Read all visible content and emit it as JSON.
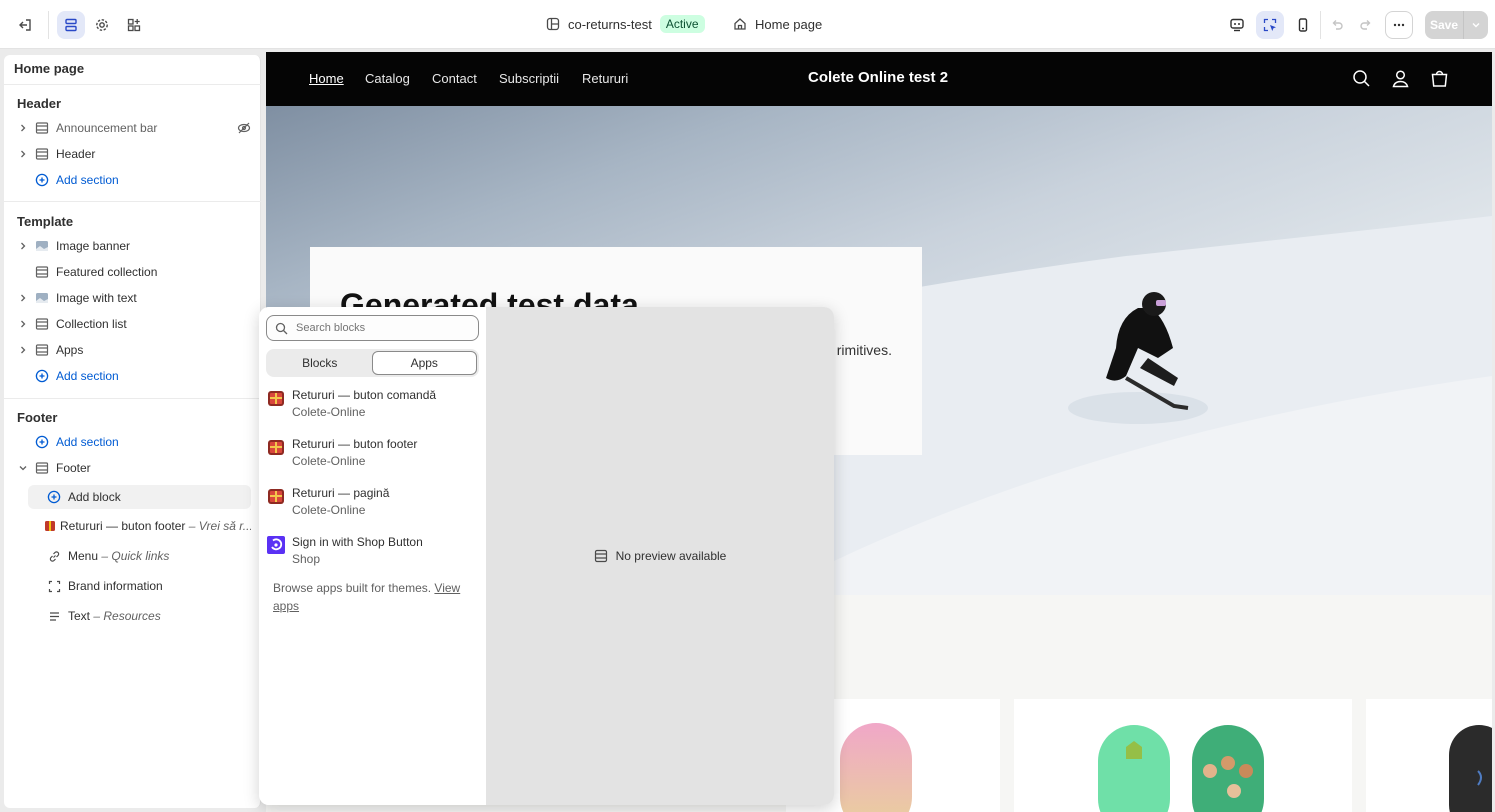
{
  "topbar": {
    "theme_name": "co-returns-test",
    "status": "Active",
    "page_label": "Home page",
    "save_label": "Save"
  },
  "sidebar": {
    "title": "Home page",
    "header_group": {
      "title": "Header",
      "items": [
        "Announcement bar",
        "Header"
      ],
      "add_label": "Add section"
    },
    "template_group": {
      "title": "Template",
      "items": [
        "Image banner",
        "Featured collection",
        "Image with text",
        "Collection list",
        "Apps"
      ],
      "add_label": "Add section"
    },
    "footer_group": {
      "title": "Footer",
      "add_label": "Add section",
      "section_label": "Footer",
      "add_block_label": "Add block",
      "blocks": [
        {
          "label": "Retururi — buton footer",
          "detail": "– Vrei să r..."
        },
        {
          "label": "Menu",
          "detail": "– Quick links"
        },
        {
          "label": "Brand information",
          "detail": ""
        },
        {
          "label": "Text",
          "detail": "– Resources"
        }
      ]
    }
  },
  "store": {
    "nav": [
      "Home",
      "Catalog",
      "Contact",
      "Subscriptii",
      "Retururi"
    ],
    "name": "Colete Online test 2",
    "hero_heading": "Generated test data",
    "hero_text": "rimitives."
  },
  "popup": {
    "search_placeholder": "Search blocks",
    "tabs": [
      "Blocks",
      "Apps"
    ],
    "apps": [
      {
        "title": "Retururi — buton comandă",
        "vendor": "Colete-Online",
        "icon": "gift-box-icon"
      },
      {
        "title": "Retururi — buton footer",
        "vendor": "Colete-Online",
        "icon": "gift-box-icon"
      },
      {
        "title": "Retururi — pagină",
        "vendor": "Colete-Online",
        "icon": "gift-box-icon"
      },
      {
        "title": "Sign in with Shop Button",
        "vendor": "Shop",
        "icon": "shop-logo-icon"
      }
    ],
    "browse_text": "Browse apps built for themes.",
    "browse_link": "View apps",
    "preview_text": "No preview available"
  },
  "colors": {
    "accent": "#005bd3",
    "badge_bg": "#cdfee1",
    "badge_text": "#0c5132",
    "store_nav_bg": "#050505",
    "shop_purple": "#5a31f4"
  }
}
